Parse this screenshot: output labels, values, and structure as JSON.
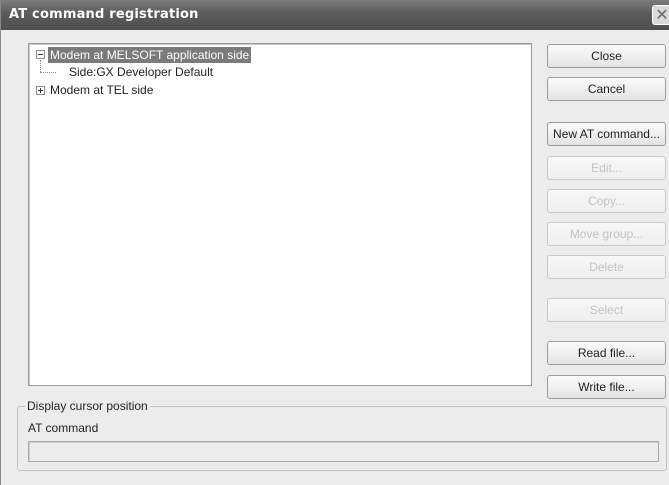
{
  "window": {
    "title": "AT command registration",
    "close_glyph": "✕"
  },
  "tree": {
    "nodes": [
      {
        "label": "Modem at MELSOFT application side",
        "expanded": true,
        "selected": true,
        "icon": "minus-expander-icon"
      },
      {
        "label": "Side:GX Developer Default",
        "expanded": null,
        "selected": false,
        "icon": "none"
      },
      {
        "label": "Modem at TEL side",
        "expanded": false,
        "selected": false,
        "icon": "plus-expander-icon"
      }
    ]
  },
  "buttons": {
    "close": "Close",
    "cancel": "Cancel",
    "new_at_command": "New AT command...",
    "edit": "Edit...",
    "copy": "Copy...",
    "move_group": "Move group...",
    "delete": "Delete",
    "select": "Select",
    "read_file": "Read file...",
    "write_file": "Write file..."
  },
  "display_cursor": {
    "group_title": "Display cursor position",
    "field_label": "AT command",
    "field_value": ""
  },
  "colors": {
    "titlebar": "#5d5d5d",
    "selection": "#7a7a7a",
    "disabled_text": "#c3c3c3"
  }
}
